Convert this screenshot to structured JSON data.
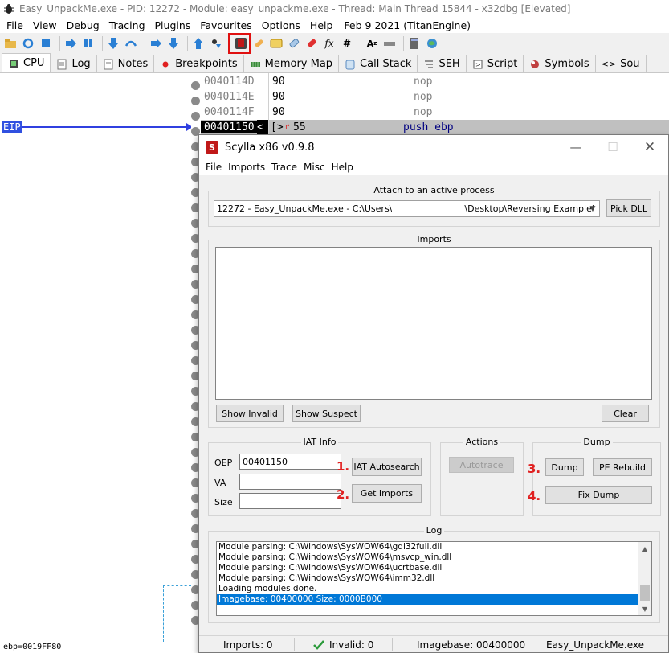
{
  "x64dbg": {
    "title": "Easy_UnpackMe.exe - PID: 12272 - Module: easy_unpackme.exe - Thread: Main Thread 15844 - x32dbg [Elevated]",
    "menu": [
      "File",
      "View",
      "Debug",
      "Tracing",
      "Plugins",
      "Favourites",
      "Options",
      "Help"
    ],
    "build_info": "Feb 9 2021 (TitanEngine)",
    "tabs": [
      {
        "label": "CPU",
        "icon": "cpu-icon"
      },
      {
        "label": "Log",
        "icon": "log-icon"
      },
      {
        "label": "Notes",
        "icon": "notes-icon"
      },
      {
        "label": "Breakpoints",
        "icon": "breakpoint-dot-icon"
      },
      {
        "label": "Memory Map",
        "icon": "memory-map-icon"
      },
      {
        "label": "Call Stack",
        "icon": "call-stack-icon"
      },
      {
        "label": "SEH",
        "icon": "seh-icon"
      },
      {
        "label": "Script",
        "icon": "script-icon"
      },
      {
        "label": "Symbols",
        "icon": "symbols-icon"
      },
      {
        "label": "Sou",
        "icon": "source-icon"
      }
    ],
    "eip_label": "EIP",
    "disasm": [
      {
        "addr": "0040114D",
        "bytes": "90",
        "instr": "nop"
      },
      {
        "addr": "0040114E",
        "bytes": "90",
        "instr": "nop"
      },
      {
        "addr": "0040114F",
        "bytes": "90",
        "instr": "nop"
      },
      {
        "addr": "00401150",
        "marker": "<",
        "bytes": "55",
        "instr": "push ebp"
      }
    ],
    "status_text": "ebp=0019FF80"
  },
  "scylla": {
    "title": "Scylla x86 v0.9.8",
    "menu": [
      "File",
      "Imports",
      "Trace",
      "Misc",
      "Help"
    ],
    "attach_group": "Attach to an active process",
    "process_prefix": "12272 - Easy_UnpackMe.exe - C:\\Users\\",
    "process_suffix": "\\Desktop\\Reversing Example'",
    "pick_dll": "Pick DLL",
    "imports_group": "Imports",
    "show_invalid": "Show Invalid",
    "show_suspect": "Show Suspect",
    "clear": "Clear",
    "iat_group": "IAT Info",
    "oep_label": "OEP",
    "oep_value": "00401150",
    "va_label": "VA",
    "va_value": "",
    "size_label": "Size",
    "size_value": "",
    "iat_autosearch": "IAT Autosearch",
    "get_imports": "Get Imports",
    "actions_group": "Actions",
    "autotrace": "Autotrace",
    "dump_group": "Dump",
    "dump": "Dump",
    "pe_rebuild": "PE Rebuild",
    "fix_dump": "Fix Dump",
    "log_group": "Log",
    "log_lines": [
      "Module parsing: C:\\Windows\\SysWOW64\\gdi32full.dll",
      "Module parsing: C:\\Windows\\SysWOW64\\msvcp_win.dll",
      "Module parsing: C:\\Windows\\SysWOW64\\ucrtbase.dll",
      "Module parsing: C:\\Windows\\SysWOW64\\imm32.dll",
      "Loading modules done.",
      "Imagebase: 00400000 Size: 0000B000"
    ],
    "status": {
      "imports": "Imports: 0",
      "invalid": "Invalid: 0",
      "imagebase": "Imagebase: 00400000",
      "module": "Easy_UnpackMe.exe"
    }
  },
  "annotations": {
    "step1": "1.",
    "step2": "2.",
    "step3": "3.",
    "step4": "4."
  },
  "colors": {
    "highlight_red": "#e01010",
    "eip_blue": "#3050e0",
    "log_selection": "#0078d7",
    "step_red": "#e02020"
  }
}
